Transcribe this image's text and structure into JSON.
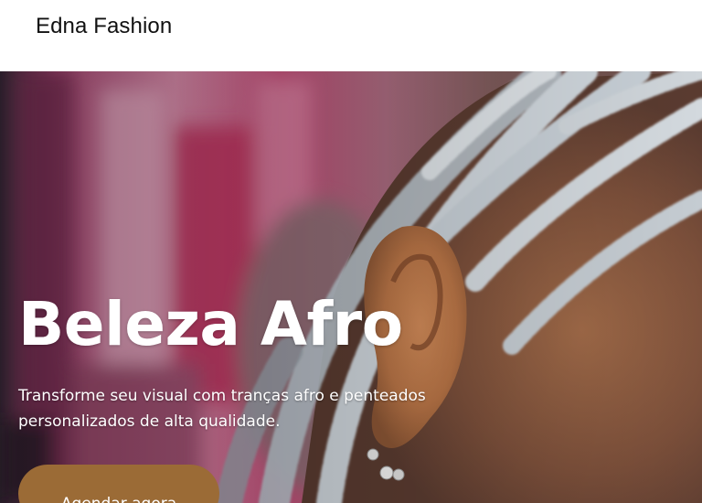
{
  "header": {
    "brand": "Edna Fashion"
  },
  "hero": {
    "image": "woman-with-braids-side-profile",
    "title": "Beleza Afro",
    "subtitle_line1": "Transforme seu visual com tranças afro e penteados",
    "subtitle_line2": "personalizados de alta qualidade.",
    "cta_label": "Agendar agora"
  },
  "colors": {
    "header_bg": "#ffffff",
    "brand_text": "#111111",
    "hero_text": "#ffffff",
    "cta_bg": "#9b6b36"
  }
}
